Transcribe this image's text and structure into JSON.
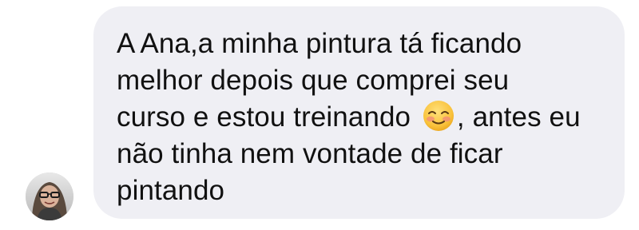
{
  "message": {
    "line_1": "A Ana,a minha pintura tá ficando",
    "line_2": "melhor depois que comprei seu",
    "line_3_before_emoji": "curso e estou treinando",
    "emoji": "smiling-face-with-blush-icon",
    "line_3_after_emoji": ", antes eu",
    "line_4": "não tinha nem vontade de ficar",
    "line_5": "pintando"
  },
  "colors": {
    "bubble_background": "#efeff4",
    "text": "#111111",
    "page_background": "#ffffff"
  }
}
